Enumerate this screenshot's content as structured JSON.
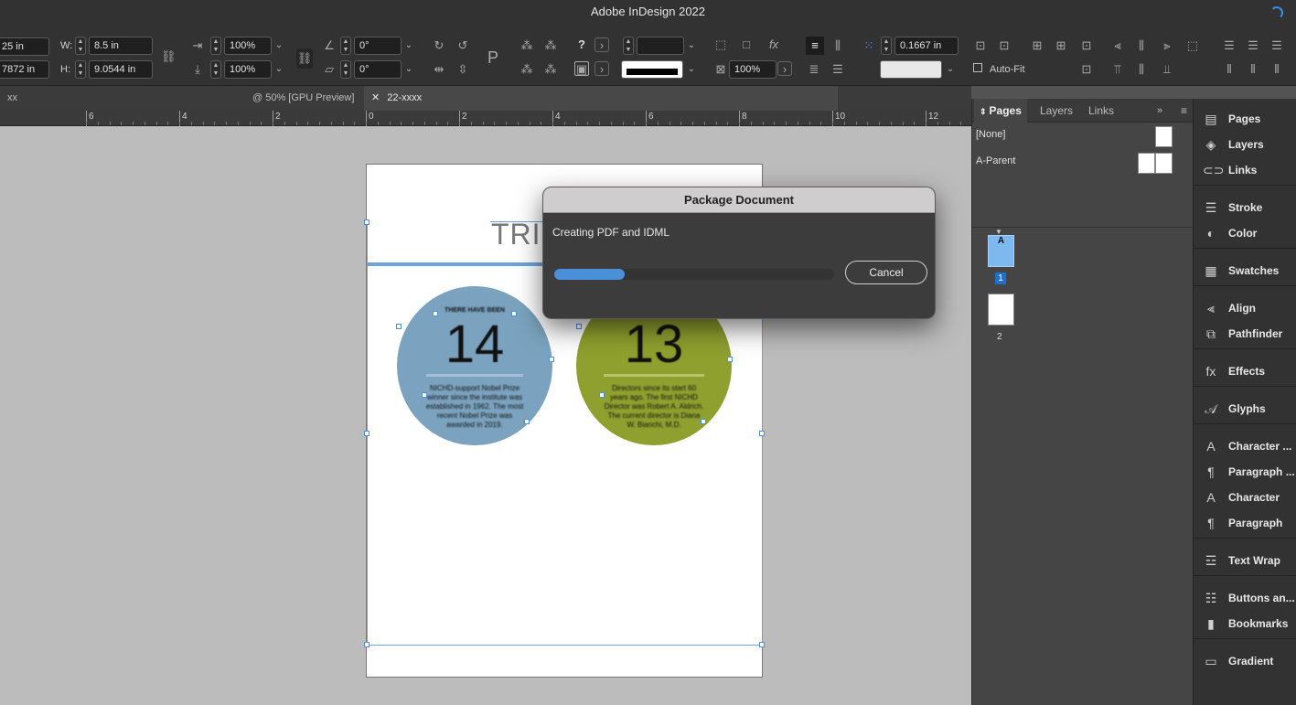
{
  "app": {
    "title": "Adobe InDesign 2022"
  },
  "control_bar": {
    "x_value": "25 in",
    "y_value": "7872 in",
    "w_label": "W:",
    "w_value": "8.5 in",
    "h_label": "H:",
    "h_value": "9.0544 in",
    "scale_x": "100%",
    "scale_y": "100%",
    "rotation": "0°",
    "shear": "0°",
    "stroke_weight": "",
    "opacity": "100%",
    "offset": "0.1667 in",
    "autofit_label": "Auto-Fit",
    "autofit_checked": false
  },
  "tabs": {
    "left_stub": "xx",
    "preview_tab": "@ 50% [GPU Preview]",
    "active_close": "✕",
    "active_tab": "22-xxxx"
  },
  "ruler": {
    "labels": [
      "6",
      "4",
      "2",
      "0",
      "2",
      "4",
      "6",
      "8",
      "10",
      "12"
    ]
  },
  "document": {
    "heading_partial": "TRI",
    "circle1": {
      "color": "#7ba3bf",
      "top_text": "THERE HAVE BEEN",
      "number": "14",
      "body": "NICHD-support Nobel Prize winner since the institute was established in 1962. The most recent Nobel Prize was awarded in 2019."
    },
    "circle2": {
      "color": "#8fa02e",
      "number": "13",
      "body": "Directors since its start 60 years ago. The first NICHD Director was Robert A. Aldrich. The current director is Diana W. Bianchi, M.D."
    }
  },
  "dialog": {
    "title": "Package Document",
    "message": "Creating PDF and IDML",
    "progress": 0.25,
    "cancel_label": "Cancel"
  },
  "pages_panel": {
    "tabs": [
      "Pages",
      "Layers",
      "Links"
    ],
    "none_label": "[None]",
    "parent_label": "A-Parent",
    "page1_letter": "A",
    "page1_number": "1",
    "page2_number": "2"
  },
  "dock": {
    "items": [
      {
        "label": "Pages",
        "icon": "pages-icon"
      },
      {
        "label": "Layers",
        "icon": "layers-icon"
      },
      {
        "label": "Links",
        "icon": "links-icon"
      },
      {
        "label": "Stroke",
        "icon": "stroke-icon"
      },
      {
        "label": "Color",
        "icon": "color-icon"
      },
      {
        "label": "Swatches",
        "icon": "swatches-icon"
      },
      {
        "label": "Align",
        "icon": "align-icon"
      },
      {
        "label": "Pathfinder",
        "icon": "pathfinder-icon"
      },
      {
        "label": "Effects",
        "icon": "effects-icon"
      },
      {
        "label": "Glyphs",
        "icon": "glyphs-icon"
      },
      {
        "label": "Character ...",
        "icon": "character-styles-icon"
      },
      {
        "label": "Paragraph ...",
        "icon": "paragraph-styles-icon"
      },
      {
        "label": "Character",
        "icon": "character-icon"
      },
      {
        "label": "Paragraph",
        "icon": "paragraph-icon"
      },
      {
        "label": "Text Wrap",
        "icon": "text-wrap-icon"
      },
      {
        "label": "Buttons an...",
        "icon": "buttons-icon"
      },
      {
        "label": "Bookmarks",
        "icon": "bookmarks-icon"
      },
      {
        "label": "Gradient",
        "icon": "gradient-icon"
      }
    ]
  }
}
